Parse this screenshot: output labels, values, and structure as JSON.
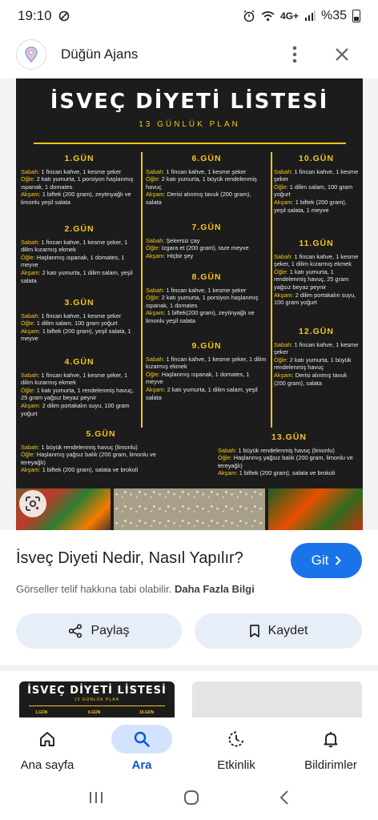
{
  "status_bar": {
    "time": "19:10",
    "battery": "%35",
    "network": "4G+"
  },
  "header": {
    "site_name": "Düğün Ajans"
  },
  "poster": {
    "title": "İSVEÇ DİYETİ LİSTESİ",
    "subtitle": "13 GÜNLÜK PLAN",
    "days": [
      {
        "title": "1.GÜN",
        "lines": [
          [
            "Sabah:",
            " 1 fincan kahve, 1 kesme şeker"
          ],
          [
            "Öğle:",
            " 2 katı yumurta, 1 porsiyon haşlanmış ıspanak, 1 domates"
          ],
          [
            "Akşam:",
            " 1 biftek (200 gram), zeytinyağlı ve limonlu yeşil salata"
          ]
        ]
      },
      {
        "title": "2.GÜN",
        "lines": [
          [
            "Sabah:",
            " 1 fincan kahve, 1 kesme şeker, 1 dilim kızarmış ekmek"
          ],
          [
            "Öğle:",
            " Haşlanmış ıspanak, 1 domates, 1 meyve"
          ],
          [
            "Akşam:",
            " 2 katı yumurta, 1 dilim salam, yeşil salata"
          ]
        ]
      },
      {
        "title": "3.GÜN",
        "lines": [
          [
            "Sabah:",
            " 1 fincan kahve, 1 kesme şeker"
          ],
          [
            "Öğle:",
            " 1 dilim salam, 100 gram yoğurt"
          ],
          [
            "Akşam:",
            " 1 biftek (200 gram), yeşil salata, 1 meyve"
          ]
        ]
      },
      {
        "title": "4.GÜN",
        "lines": [
          [
            "Sabah:",
            " 1 fincan kahve, 1 kesme şeker, 1 dilim kızarmış ekmek"
          ],
          [
            "Öğle:",
            " 1 katı yumurta, 1 rendelenmiş havuç, 25 gram yağsız beyaz peynir"
          ],
          [
            "Akşam:",
            " 2 dilim portakalın suyu, 100 gram yoğurt"
          ]
        ]
      },
      {
        "title": "5.GÜN",
        "lines": [
          [
            "Sabah:",
            " 1 büyük rendelenmiş havuç (limonlu)"
          ],
          [
            "Öğle:",
            " Haşlanmış yağsız balık (200 gram, limonlu ve tereyağlı)"
          ],
          [
            "Akşam:",
            " 1 biftek (200 gram), salata ve brokoli"
          ]
        ]
      },
      {
        "title": "6.GÜN",
        "lines": [
          [
            "Sabah:",
            " 1 fincan kahve, 1 kesme şeker"
          ],
          [
            "Öğle:",
            " 2 katı yumurta, 1 büyük rendelenmiş havuç"
          ],
          [
            "Akşam:",
            " Derisi alınmış tavuk (200 gram), salata"
          ]
        ]
      },
      {
        "title": "7.GÜN",
        "lines": [
          [
            "Sabah:",
            " Şekersiz çay"
          ],
          [
            "Öğle:",
            " Izgara et (200 gram), taze meyve"
          ],
          [
            "Akşam:",
            " Hiçbir şey"
          ]
        ]
      },
      {
        "title": "8.GÜN",
        "lines": [
          [
            "Sabah:",
            " 1 fincan kahve, 1 kesme şeker"
          ],
          [
            "Öğle:",
            " 2 katı yumurta, 1 porsiyon haşlanmış ıspanak, 1 domates"
          ],
          [
            "Akşam:",
            " 1 biftek(200 gram), zeytinyağlı ve limonlu yeşil salata"
          ]
        ]
      },
      {
        "title": "9.GÜN",
        "lines": [
          [
            "Sabah:",
            " 1 fincan kahve, 1 kesme şeker, 1 dilim kızarmış ekmek"
          ],
          [
            "Öğle:",
            " Haşlanmış ıspanak, 1 domates, 1 meyve"
          ],
          [
            "Akşam:",
            " 2 katı yumurta, 1 dilim salam, yeşil salata"
          ]
        ]
      },
      {
        "title": "10.GÜN",
        "lines": [
          [
            "Sabah:",
            " 1 fincan kahve, 1 kesme şeker"
          ],
          [
            "Öğle:",
            " 1 dilim salam, 100 gram yoğurt"
          ],
          [
            "Akşam:",
            " 1 biftek (200 gram), yeşil salata, 1 meyve"
          ]
        ]
      },
      {
        "title": "11.GÜN",
        "lines": [
          [
            "Sabah:",
            " 1 fincan kahve, 1 kesme şeker, 1 dilim kızarmış ekmek"
          ],
          [
            "Öğle:",
            " 1 katı yumurta, 1 rendelenmiş havuç, 25 gram yağsız beyaz peynir"
          ],
          [
            "Akşam:",
            " 2 dilim portakalın suyu, 100 gram yoğurt"
          ]
        ]
      },
      {
        "title": "12.GÜN",
        "lines": [
          [
            "Sabah:",
            " 1 fincan kahve, 1 kesme şeker"
          ],
          [
            "Öğle:",
            " 2 katı yumurta, 1 büyük rendelenmiş havuç"
          ],
          [
            "Akşam:",
            " Derisi alınmış tavuk (200 gram), salata"
          ]
        ]
      },
      {
        "title": "13.GÜN",
        "lines": [
          [
            "Sabah:",
            " 1 büyük rendelenmiş havuç (limonlu)"
          ],
          [
            "Öğle:",
            " Haşlanmış yağsız balık (200 gram, limonlu ve tereyağlı)"
          ],
          [
            "Akşam:",
            " 1 biftek (200 gram), salata ve brokoli"
          ]
        ]
      }
    ]
  },
  "result": {
    "title": "İsveç Diyeti Nedir, Nasıl Yapılır?",
    "go_label": "Git",
    "copyright": "Görseller telif hakkına tabi olabilir.",
    "more_info": "Daha Fazla Bilgi"
  },
  "actions": {
    "share_label": "Paylaş",
    "save_label": "Kaydet"
  },
  "related": {
    "thumb1_title": "İSVEÇ DİYETİ LİSTESİ",
    "thumb1_sub": "13 GÜNLÜK PLAN",
    "thumb1_days": [
      "1.GÜN",
      "6.GÜN",
      "10.GÜN"
    ]
  },
  "bottom_nav": {
    "items": [
      {
        "label": "Ana sayfa",
        "icon": "home-icon"
      },
      {
        "label": "Ara",
        "icon": "search-icon",
        "active": true
      },
      {
        "label": "Etkinlik",
        "icon": "activity-icon"
      },
      {
        "label": "Bildirimler",
        "icon": "bell-icon"
      }
    ]
  },
  "colors": {
    "accent": "#1a73e8",
    "poster_bg": "#1c1c1c",
    "poster_yellow": "#f5c518",
    "nav_active_bg": "#d3e3fd"
  }
}
